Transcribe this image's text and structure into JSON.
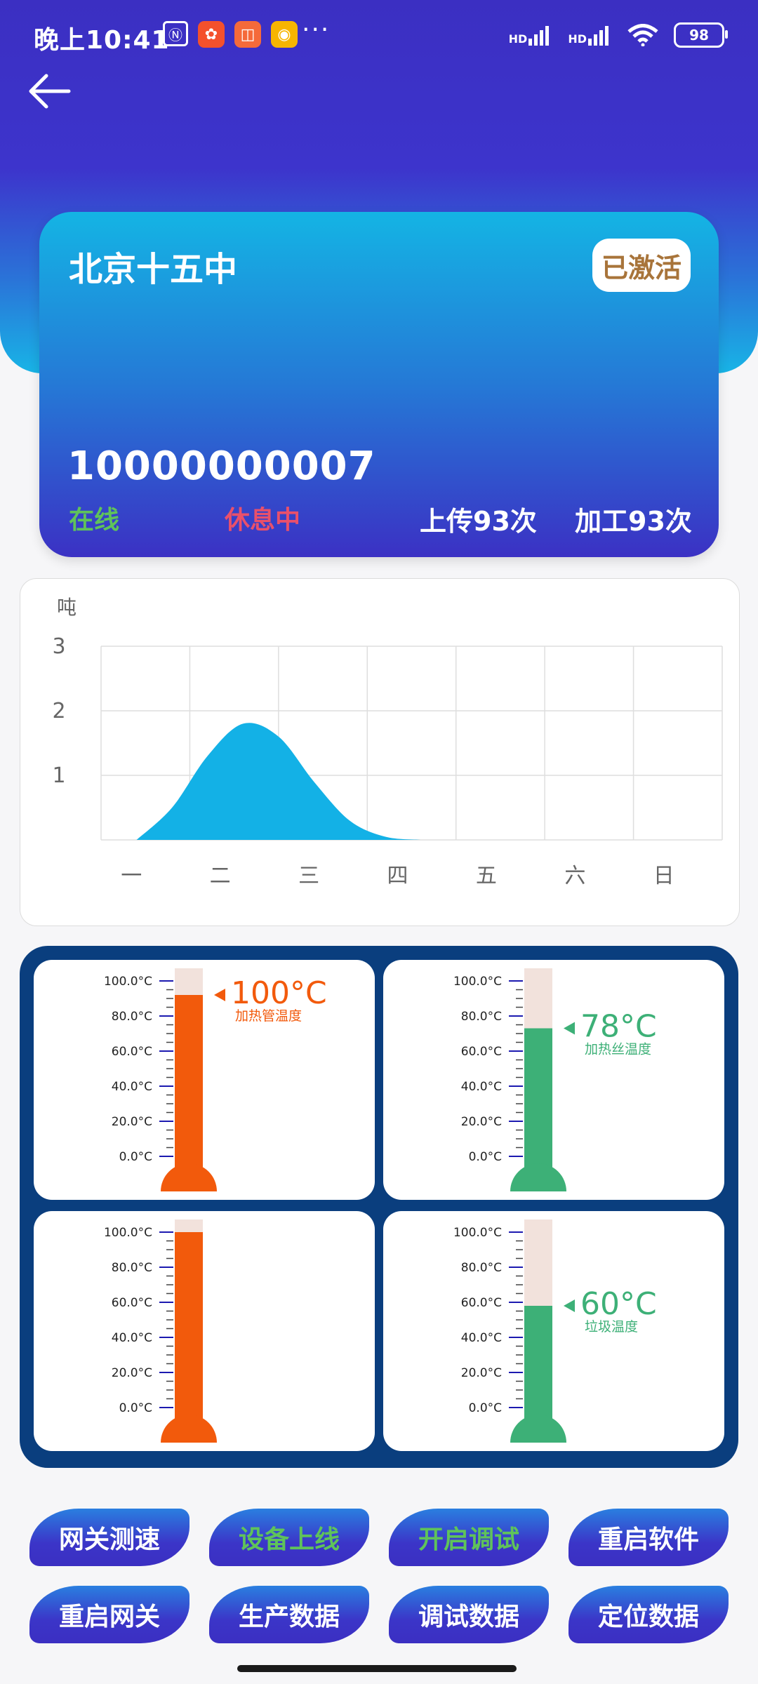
{
  "status_bar": {
    "time": "晚上10:41",
    "hd1": "HD",
    "hd2": "HD",
    "battery": "98"
  },
  "card": {
    "school": "北京十五中",
    "badge": "已激活",
    "device_id": "10000000007",
    "online": "在线",
    "state": "休息中",
    "upload": "上传93次",
    "process": "加工93次"
  },
  "colors": {
    "header_top": "#3b2fc2",
    "header_bottom": "#18b4e6",
    "chart_fill": "#13b1e6",
    "orange": "#f25a0c",
    "green": "#3db077",
    "panel": "#0a3e7e"
  },
  "chart_data": {
    "type": "area",
    "ylabel": "吨",
    "categories": [
      "一",
      "二",
      "三",
      "四",
      "五",
      "六",
      "日"
    ],
    "yticks": [
      "1",
      "2",
      "3"
    ],
    "ylim": [
      0,
      3
    ],
    "x": [
      0.8,
      1.2,
      1.6,
      2.0,
      2.4,
      2.8,
      3.2,
      3.6,
      4.0
    ],
    "values": [
      0,
      0.5,
      1.3,
      1.8,
      1.6,
      0.9,
      0.3,
      0.05,
      0
    ],
    "grid": true
  },
  "thermometers": {
    "scale": [
      "100.0°C",
      "80.0°C",
      "60.0°C",
      "40.0°C",
      "20.0°C",
      "0.0°C"
    ],
    "items": [
      {
        "value_text": "100°C",
        "label": "加热管温度",
        "level": 0.92,
        "color": "#f25a0c",
        "show_label": true
      },
      {
        "value_text": "78°C",
        "label": "加热丝温度",
        "level": 0.73,
        "color": "#3db077",
        "show_label": true
      },
      {
        "value_text": "",
        "label": "",
        "level": 1.0,
        "color": "#f25a0c",
        "show_label": false
      },
      {
        "value_text": "60°C",
        "label": "垃圾温度",
        "level": 0.58,
        "color": "#3db077",
        "show_label": true
      }
    ]
  },
  "buttons": [
    {
      "label": "网关测速",
      "active": true
    },
    {
      "label": "设备上线",
      "active": false
    },
    {
      "label": "开启调试",
      "active": false
    },
    {
      "label": "重启软件",
      "active": true
    },
    {
      "label": "重启网关",
      "active": true
    },
    {
      "label": "生产数据",
      "active": true
    },
    {
      "label": "调试数据",
      "active": true
    },
    {
      "label": "定位数据",
      "active": true
    }
  ]
}
